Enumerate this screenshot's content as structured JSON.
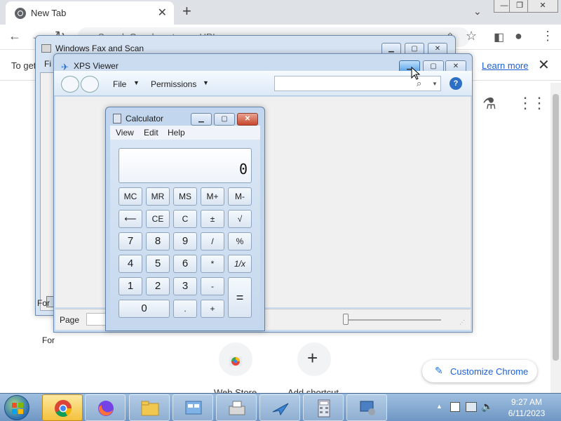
{
  "chrome": {
    "tab_title": "New Tab",
    "omnibox_placeholder": "Search Google or type a URL",
    "infobar_text": "To get",
    "infobar_learn_more": "Learn more",
    "shortcuts": [
      "Web Store",
      "Add shortcut"
    ],
    "customize_label": "Customize Chrome"
  },
  "fax": {
    "title": "Windows Fax and Scan",
    "menu_fragment": "Fi",
    "status_fragment": "For"
  },
  "xps": {
    "title": "XPS Viewer",
    "menu_file": "File",
    "menu_permissions": "Permissions",
    "status_page_label": "Page"
  },
  "calc": {
    "title": "Calculator",
    "menu": [
      "View",
      "Edit",
      "Help"
    ],
    "display": "0",
    "keys": [
      "MC",
      "MR",
      "MS",
      "M+",
      "M-",
      "⟵",
      "CE",
      "C",
      "±",
      "√",
      "7",
      "8",
      "9",
      "/",
      "%",
      "4",
      "5",
      "6",
      "*",
      "1/x",
      "1",
      "2",
      "3",
      "-",
      "=",
      "0",
      ".",
      "+"
    ]
  },
  "taskbar": {
    "time": "9:27 AM",
    "date": "6/11/2023",
    "items": [
      "chrome",
      "firefox",
      "file-explorer",
      "control-panel",
      "fax-scan",
      "xps-viewer",
      "calculator",
      "remote-desktop"
    ]
  },
  "colors": {
    "taskbar": "#6f97c4",
    "accent_link": "#1a5fd6",
    "calc_close": "#c8452c"
  }
}
